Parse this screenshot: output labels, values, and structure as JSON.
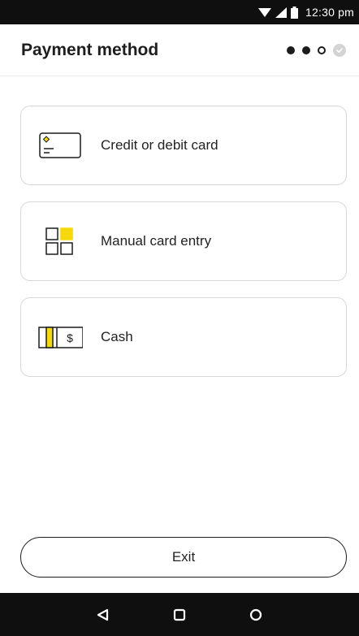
{
  "status_bar": {
    "time": "12:30 pm",
    "icons": [
      "wifi-icon",
      "signal-icon",
      "battery-icon"
    ]
  },
  "header": {
    "title": "Payment method",
    "steps": [
      "complete",
      "complete",
      "current",
      "done-check"
    ]
  },
  "options": [
    {
      "label": "Credit or debit card",
      "icon": "credit-card-icon"
    },
    {
      "label": "Manual card entry",
      "icon": "grid-keypad-icon"
    },
    {
      "label": "Cash",
      "icon": "cash-icon"
    }
  ],
  "footer": {
    "exit_label": "Exit"
  },
  "nav_bar": {
    "buttons": [
      "back-icon",
      "recents-icon",
      "home-icon"
    ]
  },
  "colors": {
    "accent": "#f5d90a",
    "text": "#1c1c1c",
    "bar": "#0f0f0f",
    "border": "#d8d8d8"
  }
}
